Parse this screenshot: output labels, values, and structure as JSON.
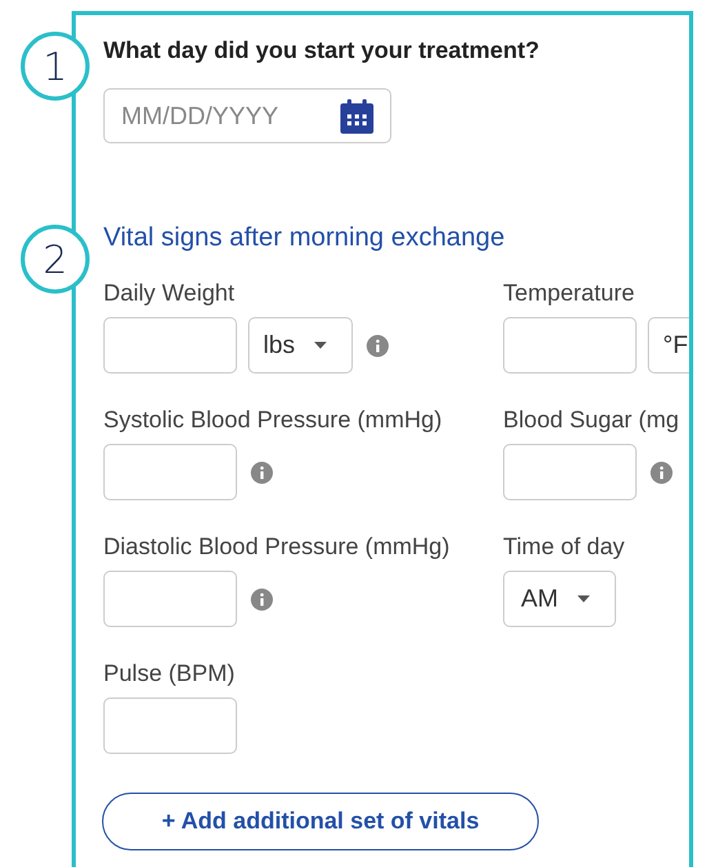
{
  "steps": [
    {
      "number": "1"
    },
    {
      "number": "2"
    }
  ],
  "question": "What day did you start your treatment?",
  "date_field": {
    "placeholder": "MM/DD/YYYY"
  },
  "section_title": "Vital signs after morning exchange",
  "fields": [
    {
      "kind": "number",
      "label": "Daily Weight",
      "unit": {
        "label": "lbs",
        "caret": true
      },
      "info": true
    },
    {
      "kind": "number",
      "label": "Temperature",
      "unit": {
        "label": "°F",
        "caret": false
      },
      "info": false
    },
    {
      "kind": "number",
      "label": "Systolic Blood Pressure (mmHg)",
      "info": true
    },
    {
      "kind": "number",
      "label": "Blood Sugar (mg",
      "info": true
    },
    {
      "kind": "number",
      "label": "Diastolic Blood Pressure (mmHg)",
      "info": true
    },
    {
      "kind": "select",
      "label": "Time of day",
      "value": "AM"
    },
    {
      "kind": "number",
      "label": "Pulse (BPM)",
      "info": false
    }
  ],
  "add_button": {
    "label": "+ Add additional set of vitals"
  }
}
